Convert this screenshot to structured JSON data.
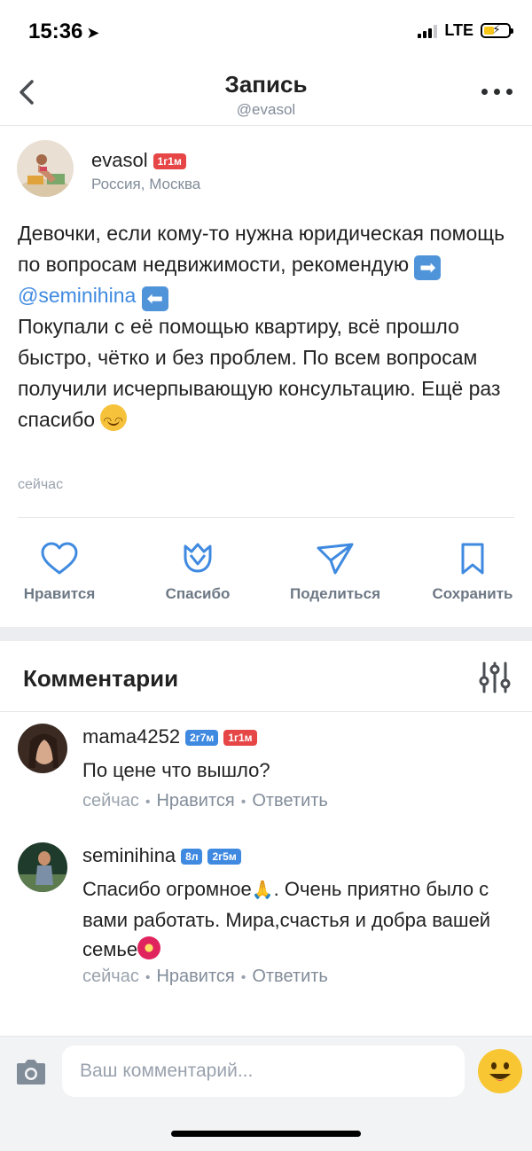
{
  "status_bar": {
    "time": "15:36",
    "time_arrow": "➤",
    "network": "LTE",
    "battery_bolt": "⚡"
  },
  "nav": {
    "title": "Запись",
    "subtitle": "@evasol",
    "back_icon": "chevron-left-icon",
    "more_icon": "more-horizontal-icon"
  },
  "post": {
    "author": "evasol",
    "author_badge": "1г1м",
    "location": "Россия, Москва",
    "text_part1": "Девочки, если кому-то нужна юридическая помощь по вопросам недвижимости, рекомендую",
    "arrow_right": "➡",
    "mention": "@seminihina",
    "arrow_left": "⬅",
    "text_part2": "Покупали с её помощью квартиру, всё прошло быстро, чётко и без проблем. По всем вопросам получили исчерпывающую консультацию. Ещё раз спасибо",
    "time": "сейчас"
  },
  "actions": [
    {
      "label": "Нравится",
      "icon": "heart-icon"
    },
    {
      "label": "Спасибо",
      "icon": "tulip-icon"
    },
    {
      "label": "Поделиться",
      "icon": "send-icon"
    },
    {
      "label": "Сохранить",
      "icon": "bookmark-icon"
    }
  ],
  "comments_section": {
    "title": "Комментарии",
    "filter_icon": "sliders-icon",
    "items": [
      {
        "name": "mama4252",
        "badges": [
          "2г7м",
          "1г1м"
        ],
        "text": "По цене что вышло?",
        "time": "сейчас",
        "like": "Нравится",
        "reply": "Ответить"
      },
      {
        "name": "seminihina",
        "badges": [
          "8л",
          "2г5м"
        ],
        "text_part1": "Спасибо огромное",
        "pray_emoji": "🙏",
        "text_part2": ". Очень приятно было с вами работать. Мира,счастья и добра вашей семье",
        "time": "сейчас",
        "like": "Нравится",
        "reply": "Ответить"
      }
    ]
  },
  "composer": {
    "placeholder": "Ваш комментарий...",
    "camera_icon": "camera-icon",
    "emoji_icon": "smiley-icon"
  },
  "colors": {
    "accent": "#3f8ae0",
    "badge_red": "#e64646",
    "secondary_text": "#818c99"
  }
}
